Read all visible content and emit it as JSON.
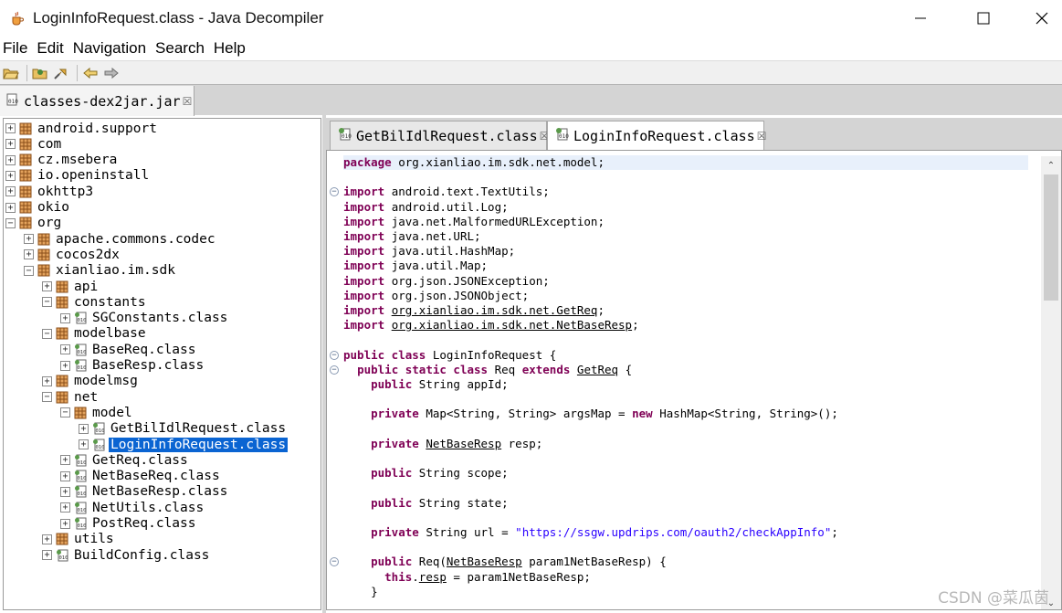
{
  "window": {
    "title": "LoginInfoRequest.class - Java Decompiler",
    "minimize_glyph": "—",
    "maximize_glyph": "☐",
    "close_glyph": "✕"
  },
  "menu": [
    "File",
    "Edit",
    "Navigation",
    "Search",
    "Help"
  ],
  "toolbar": {
    "icons": [
      "open-file-icon",
      "open-type-icon",
      "search-icon",
      "back-icon",
      "forward-icon"
    ]
  },
  "jar_tab": {
    "label": "classes-dex2jar.jar",
    "close": "☒"
  },
  "tree": [
    {
      "label": "android.support",
      "depth": 0,
      "toggle": "+",
      "kind": "package"
    },
    {
      "label": "com",
      "depth": 0,
      "toggle": "+",
      "kind": "package"
    },
    {
      "label": "cz.msebera",
      "depth": 0,
      "toggle": "+",
      "kind": "package"
    },
    {
      "label": "io.openinstall",
      "depth": 0,
      "toggle": "+",
      "kind": "package"
    },
    {
      "label": "okhttp3",
      "depth": 0,
      "toggle": "+",
      "kind": "package"
    },
    {
      "label": "okio",
      "depth": 0,
      "toggle": "+",
      "kind": "package"
    },
    {
      "label": "org",
      "depth": 0,
      "toggle": "−",
      "kind": "package"
    },
    {
      "label": "apache.commons.codec",
      "depth": 1,
      "toggle": "+",
      "kind": "package"
    },
    {
      "label": "cocos2dx",
      "depth": 1,
      "toggle": "+",
      "kind": "package"
    },
    {
      "label": "xianliao.im.sdk",
      "depth": 1,
      "toggle": "−",
      "kind": "package"
    },
    {
      "label": "api",
      "depth": 2,
      "toggle": "+",
      "kind": "package"
    },
    {
      "label": "constants",
      "depth": 2,
      "toggle": "−",
      "kind": "package"
    },
    {
      "label": "SGConstants.class",
      "depth": 3,
      "toggle": "+",
      "kind": "class"
    },
    {
      "label": "modelbase",
      "depth": 2,
      "toggle": "−",
      "kind": "package"
    },
    {
      "label": "BaseReq.class",
      "depth": 3,
      "toggle": "+",
      "kind": "class"
    },
    {
      "label": "BaseResp.class",
      "depth": 3,
      "toggle": "+",
      "kind": "class"
    },
    {
      "label": "modelmsg",
      "depth": 2,
      "toggle": "+",
      "kind": "package"
    },
    {
      "label": "net",
      "depth": 2,
      "toggle": "−",
      "kind": "package"
    },
    {
      "label": "model",
      "depth": 3,
      "toggle": "−",
      "kind": "package"
    },
    {
      "label": "GetBilIdlRequest.class",
      "depth": 4,
      "toggle": "+",
      "kind": "class"
    },
    {
      "label": "LoginInfoRequest.class",
      "depth": 4,
      "toggle": "+",
      "kind": "class",
      "selected": true
    },
    {
      "label": "GetReq.class",
      "depth": 3,
      "toggle": "+",
      "kind": "class"
    },
    {
      "label": "NetBaseReq.class",
      "depth": 3,
      "toggle": "+",
      "kind": "class"
    },
    {
      "label": "NetBaseResp.class",
      "depth": 3,
      "toggle": "+",
      "kind": "class"
    },
    {
      "label": "NetUtils.class",
      "depth": 3,
      "toggle": "+",
      "kind": "class"
    },
    {
      "label": "PostReq.class",
      "depth": 3,
      "toggle": "+",
      "kind": "class"
    },
    {
      "label": "utils",
      "depth": 2,
      "toggle": "+",
      "kind": "package"
    },
    {
      "label": "BuildConfig.class",
      "depth": 2,
      "toggle": "+",
      "kind": "class"
    }
  ],
  "editor_tabs": [
    {
      "label": "GetBilIdlRequest.class",
      "close": "☒",
      "active": false
    },
    {
      "label": "LoginInfoRequest.class",
      "close": "☒",
      "active": true
    }
  ],
  "code": [
    {
      "line": 0,
      "tokens": [
        [
          "kw",
          "package"
        ],
        [
          "",
          "org.xianliao.im.sdk.net.model;"
        ]
      ],
      "highlight": true
    },
    {
      "line": 2,
      "fold": true,
      "tokens": [
        [
          "kw",
          "import"
        ],
        [
          "",
          "android.text.TextUtils;"
        ]
      ]
    },
    {
      "line": 3,
      "tokens": [
        [
          "kw",
          "import"
        ],
        [
          "",
          "android.util.Log;"
        ]
      ]
    },
    {
      "line": 4,
      "tokens": [
        [
          "kw",
          "import"
        ],
        [
          "",
          "java.net.MalformedURLException;"
        ]
      ]
    },
    {
      "line": 5,
      "tokens": [
        [
          "kw",
          "import"
        ],
        [
          "",
          "java.net.URL;"
        ]
      ]
    },
    {
      "line": 6,
      "tokens": [
        [
          "kw",
          "import"
        ],
        [
          "",
          "java.util.HashMap;"
        ]
      ]
    },
    {
      "line": 7,
      "tokens": [
        [
          "kw",
          "import"
        ],
        [
          "",
          "java.util.Map;"
        ]
      ]
    },
    {
      "line": 8,
      "tokens": [
        [
          "kw",
          "import"
        ],
        [
          "",
          "org.json.JSONException;"
        ]
      ]
    },
    {
      "line": 9,
      "tokens": [
        [
          "kw",
          "import"
        ],
        [
          "",
          "org.json.JSONObject;"
        ]
      ]
    },
    {
      "line": 10,
      "tokens": [
        [
          "kw",
          "import"
        ],
        [
          "ul",
          "org.xianliao.im.sdk.net.GetReq"
        ],
        [
          "",
          ";"
        ]
      ]
    },
    {
      "line": 11,
      "tokens": [
        [
          "kw",
          "import"
        ],
        [
          "ul",
          "org.xianliao.im.sdk.net.NetBaseResp"
        ],
        [
          "",
          ";"
        ]
      ]
    },
    {
      "line": 13,
      "fold": true,
      "tokens": [
        [
          "kw",
          "public class"
        ],
        [
          "",
          "LoginInfoRequest {"
        ]
      ]
    },
    {
      "line": 14,
      "fold": true,
      "tokens": [
        [
          "",
          "  "
        ],
        [
          "kw",
          "public static class"
        ],
        [
          "",
          "Req "
        ],
        [
          "kw",
          "extends"
        ],
        [
          "ul",
          "GetReq"
        ],
        [
          "",
          " {"
        ]
      ]
    },
    {
      "line": 15,
      "tokens": [
        [
          "",
          "    "
        ],
        [
          "kw",
          "public"
        ],
        [
          "",
          "String appId;"
        ]
      ]
    },
    {
      "line": 17,
      "tokens": [
        [
          "",
          "    "
        ],
        [
          "kw",
          "private"
        ],
        [
          "",
          "Map<String, String> argsMap = "
        ],
        [
          "kw",
          "new"
        ],
        [
          "",
          "HashMap<String, String>();"
        ]
      ]
    },
    {
      "line": 19,
      "tokens": [
        [
          "",
          "    "
        ],
        [
          "kw",
          "private"
        ],
        [
          "ul",
          "NetBaseResp"
        ],
        [
          "",
          " resp;"
        ]
      ]
    },
    {
      "line": 21,
      "tokens": [
        [
          "",
          "    "
        ],
        [
          "kw",
          "public"
        ],
        [
          "",
          "String scope;"
        ]
      ]
    },
    {
      "line": 23,
      "tokens": [
        [
          "",
          "    "
        ],
        [
          "kw",
          "public"
        ],
        [
          "",
          "String state;"
        ]
      ]
    },
    {
      "line": 25,
      "tokens": [
        [
          "",
          "    "
        ],
        [
          "kw",
          "private"
        ],
        [
          "",
          "String url = "
        ],
        [
          "str",
          "\"https://ssgw.updrips.com/oauth2/checkAppInfo\""
        ],
        [
          "",
          ";"
        ]
      ]
    },
    {
      "line": 27,
      "fold": true,
      "tokens": [
        [
          "",
          "    "
        ],
        [
          "kw",
          "public"
        ],
        [
          "",
          "Req("
        ],
        [
          "ul",
          "NetBaseResp"
        ],
        [
          "",
          " param1NetBaseResp) {"
        ]
      ]
    },
    {
      "line": 28,
      "tokens": [
        [
          "",
          "      "
        ],
        [
          "kw",
          "this"
        ],
        [
          "",
          "."
        ],
        [
          "ul",
          "resp"
        ],
        [
          "",
          " = param1NetBaseResp;"
        ]
      ]
    },
    {
      "line": 29,
      "tokens": [
        [
          "",
          "    }"
        ]
      ]
    }
  ],
  "scrollbar": {
    "up": "⌃",
    "down": "⌄"
  },
  "watermark": "CSDN @菜瓜茵"
}
